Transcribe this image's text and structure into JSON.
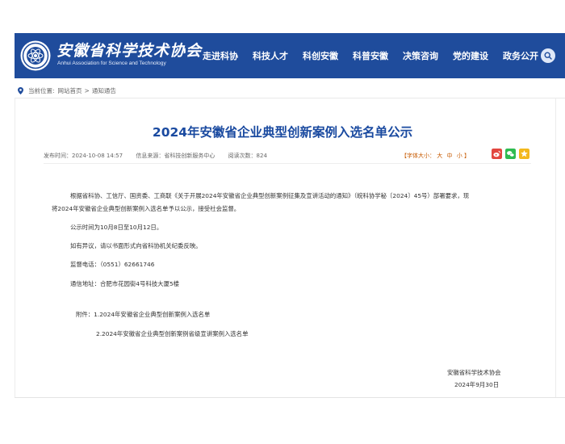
{
  "header": {
    "logo_cn": "安徽省科学技术协会",
    "logo_en": "Anhui Association for Science and Technology",
    "nav": [
      "走进科协",
      "科技人才",
      "科创安徽",
      "科普安徽",
      "决策咨询",
      "党的建设",
      "政务公开"
    ]
  },
  "breadcrumb": {
    "prefix": "当前位置:",
    "home": "网站首页",
    "separator": ">",
    "current": "通知通告"
  },
  "article": {
    "title": "2024年安徽省企业典型创新案例入选名单公示",
    "publish_time": "发布时间：2024-10-08 14:57",
    "source": "信息来源：省科技创新服务中心",
    "views": "阅读次数：824",
    "font_size_label": "【字体大小：",
    "font_large": "大",
    "font_medium": "中",
    "font_small": "小",
    "font_size_end": "】",
    "paragraph_1_line_1": "根据省科协、工信厅、国资委、工商联《关于开展2024年安徽省企业典型创新案例征集及宣讲活动的通知》（皖科协学秘〔2024〕45号）部署要求，现",
    "paragraph_1_line_2": "将2024年安徽省企业典型创新案例入选名单予以公示，接受社会监督。",
    "period": "公示时间为10月8日至10月12日。",
    "objection": "如有异议，请以书面形式向省科协机关纪委反映。",
    "phone": "监督电话：（0551）62661746",
    "address": "通信地址：合肥市花园街4号科技大厦5楼",
    "attachment_1": "附件：1.2024年安徽省企业典型创新案例入选名单",
    "attachment_2": "2.2024年安徽省企业典型创新案例省级宣讲案例入选名单",
    "signature": "安徽省科学技术协会",
    "date": "2024年9月30日"
  },
  "colors": {
    "header_bg": "#1f4c9c",
    "title": "#1a4aa0",
    "weibo": "#e2463f",
    "wechat": "#2fbb51",
    "qzone": "#f3b81c"
  },
  "icons": [
    "location-pin-icon",
    "search-icon",
    "weibo-icon",
    "wechat-icon",
    "qzone-icon",
    "emblem-icon"
  ]
}
